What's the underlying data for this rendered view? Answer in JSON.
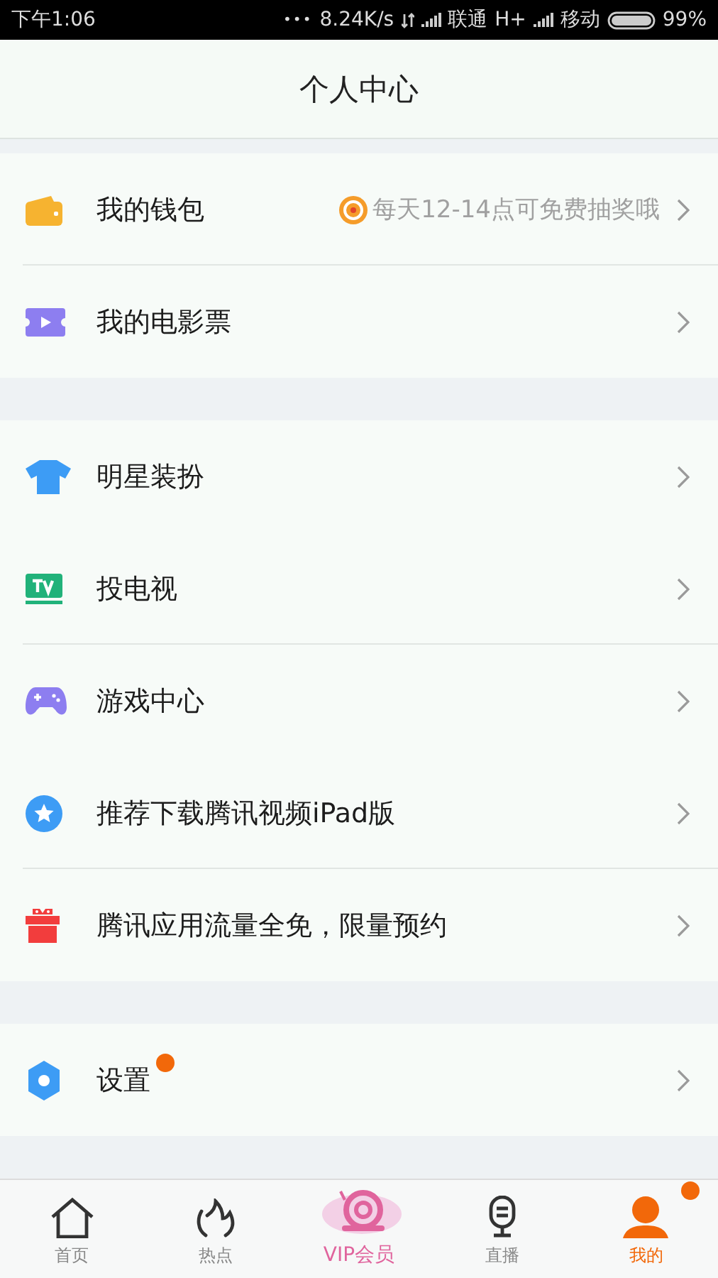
{
  "status_bar": {
    "time": "下午1:06",
    "dots": "•••",
    "speed": "8.24K/s",
    "carrier_1": "联通",
    "network_1": "H+",
    "carrier_2": "移动",
    "battery": "99%"
  },
  "header": {
    "title": "个人中心"
  },
  "sections": [
    {
      "rows": [
        {
          "label": "我的钱包",
          "promo": "每天12-14点可免费抽奖哦",
          "badge": false,
          "divider": true
        },
        {
          "label": "我的电影票",
          "badge": false,
          "divider": false
        }
      ]
    },
    {
      "rows": [
        {
          "label": "明星装扮",
          "badge": false,
          "divider": false
        },
        {
          "label": "投电视",
          "badge": false,
          "divider": true
        },
        {
          "label": "游戏中心",
          "badge": false,
          "divider": false
        },
        {
          "label": "推荐下载腾讯视频iPad版",
          "badge": false,
          "divider": true
        },
        {
          "label": "腾讯应用流量全免，限量预约",
          "badge": false,
          "divider": false
        }
      ]
    },
    {
      "rows": [
        {
          "label": "设置",
          "badge": true,
          "divider": false
        }
      ]
    }
  ],
  "tabs": [
    {
      "label": "首页",
      "kind": "normal",
      "selected": false,
      "badge": false
    },
    {
      "label": "热点",
      "kind": "normal",
      "selected": false,
      "badge": false
    },
    {
      "label": "VIP会员",
      "kind": "vip",
      "selected": false,
      "badge": false
    },
    {
      "label": "直播",
      "kind": "normal",
      "selected": false,
      "badge": false
    },
    {
      "label": "我的",
      "kind": "normal",
      "selected": true,
      "badge": true
    }
  ]
}
